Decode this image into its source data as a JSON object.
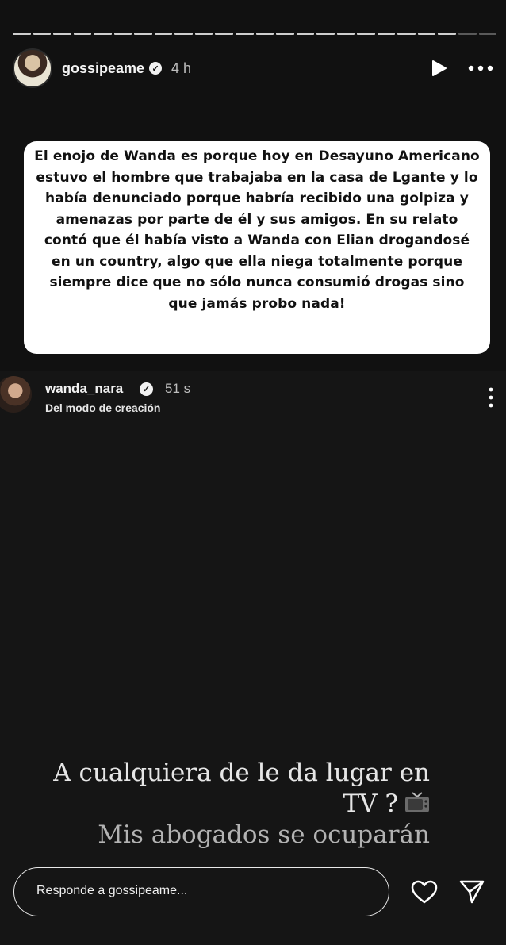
{
  "story": {
    "progress": {
      "segments_complete": 22,
      "segments_total": 24
    },
    "header": {
      "username": "gossipeame",
      "time": "4 h",
      "icons": {
        "play": "play-icon",
        "more": "more-horizontal-icon",
        "verified": "verified-badge-icon"
      }
    },
    "caption": "El enojo de Wanda es porque hoy en Desayuno Americano estuvo el hombre que trabajaba en la casa de Lgante y lo había denunciado porque habría recibido una golpiza y amenazas por parte de él y sus amigos. En su relato contó que él había visto a Wanda con Elian drogandosé en un country, algo que ella niega totalmente porque siempre dice que no sólo nunca consumió drogas sino que jamás probo nada!"
  },
  "repost": {
    "username": "wanda_nara",
    "time": "51 s",
    "subtitle": "Del modo de creación",
    "overlay_lines": [
      "A cualquiera de le da lugar en",
      "TV ?",
      "Mis abogados se ocuparán"
    ],
    "overlay_emoji": "tv-icon"
  },
  "footer": {
    "reply_placeholder": "Responde a gossipeame...",
    "icons": {
      "like": "heart-icon",
      "send": "send-icon"
    }
  }
}
